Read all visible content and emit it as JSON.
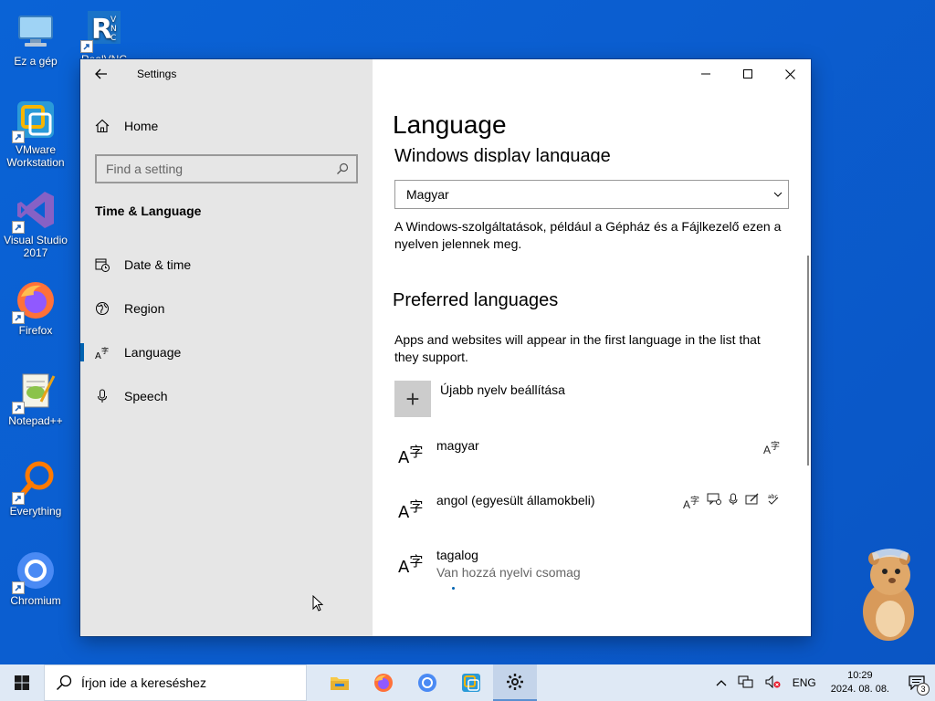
{
  "desktop": {
    "icons": [
      {
        "label": "Ez a gép",
        "icon": "computer-icon"
      },
      {
        "label": "RealVNC",
        "icon": "vnc-icon"
      },
      {
        "label": "VMware\nWorkstation",
        "icon": "vmware-icon"
      },
      {
        "label": "Visual Studio\n2017",
        "icon": "visual-studio-icon"
      },
      {
        "label": "Firefox",
        "icon": "firefox-icon"
      },
      {
        "label": "Notepad++",
        "icon": "notepadpp-icon"
      },
      {
        "label": "Everything",
        "icon": "everything-icon"
      },
      {
        "label": "Chromium",
        "icon": "chromium-icon"
      }
    ]
  },
  "window": {
    "app_title": "Settings",
    "sidebar": {
      "home_label": "Home",
      "search_placeholder": "Find a setting",
      "section_title": "Time & Language",
      "items": [
        {
          "label": "Date & time",
          "icon": "calendar-clock-icon"
        },
        {
          "label": "Region",
          "icon": "globe-icon"
        },
        {
          "label": "Language",
          "icon": "language-icon",
          "active": true
        },
        {
          "label": "Speech",
          "icon": "microphone-icon"
        }
      ]
    },
    "content": {
      "title": "Language",
      "display_language_heading": "Windows display language",
      "display_language_value": "Magyar",
      "display_language_desc": "A Windows-szolgáltatások, például a Gépház és a Fájlkezelő ezen a nyelven jelennek meg.",
      "preferred_heading": "Preferred languages",
      "preferred_desc": "Apps and websites will appear in the first language in the list that they support.",
      "add_language_label": "Újabb nyelv beállítása",
      "languages": [
        {
          "name": "magyar",
          "sub": "",
          "features": [
            "display-language-icon"
          ]
        },
        {
          "name": "angol (egyesült államokbeli)",
          "sub": "",
          "features": [
            "display-language-icon",
            "speech-icon",
            "microphone-icon",
            "handwriting-icon",
            "spellcheck-icon"
          ]
        },
        {
          "name": "tagalog",
          "sub": "Van hozzá nyelvi csomag",
          "features": []
        }
      ]
    }
  },
  "taskbar": {
    "search_placeholder": "Írjon ide a kereséshez",
    "apps": [
      "file-explorer-icon",
      "firefox-icon",
      "chromium-icon",
      "vmware-icon",
      "settings-icon"
    ],
    "tray_lang": "ENG",
    "time": "10:29",
    "date": "2024. 08. 08.",
    "notification_count": "3"
  }
}
